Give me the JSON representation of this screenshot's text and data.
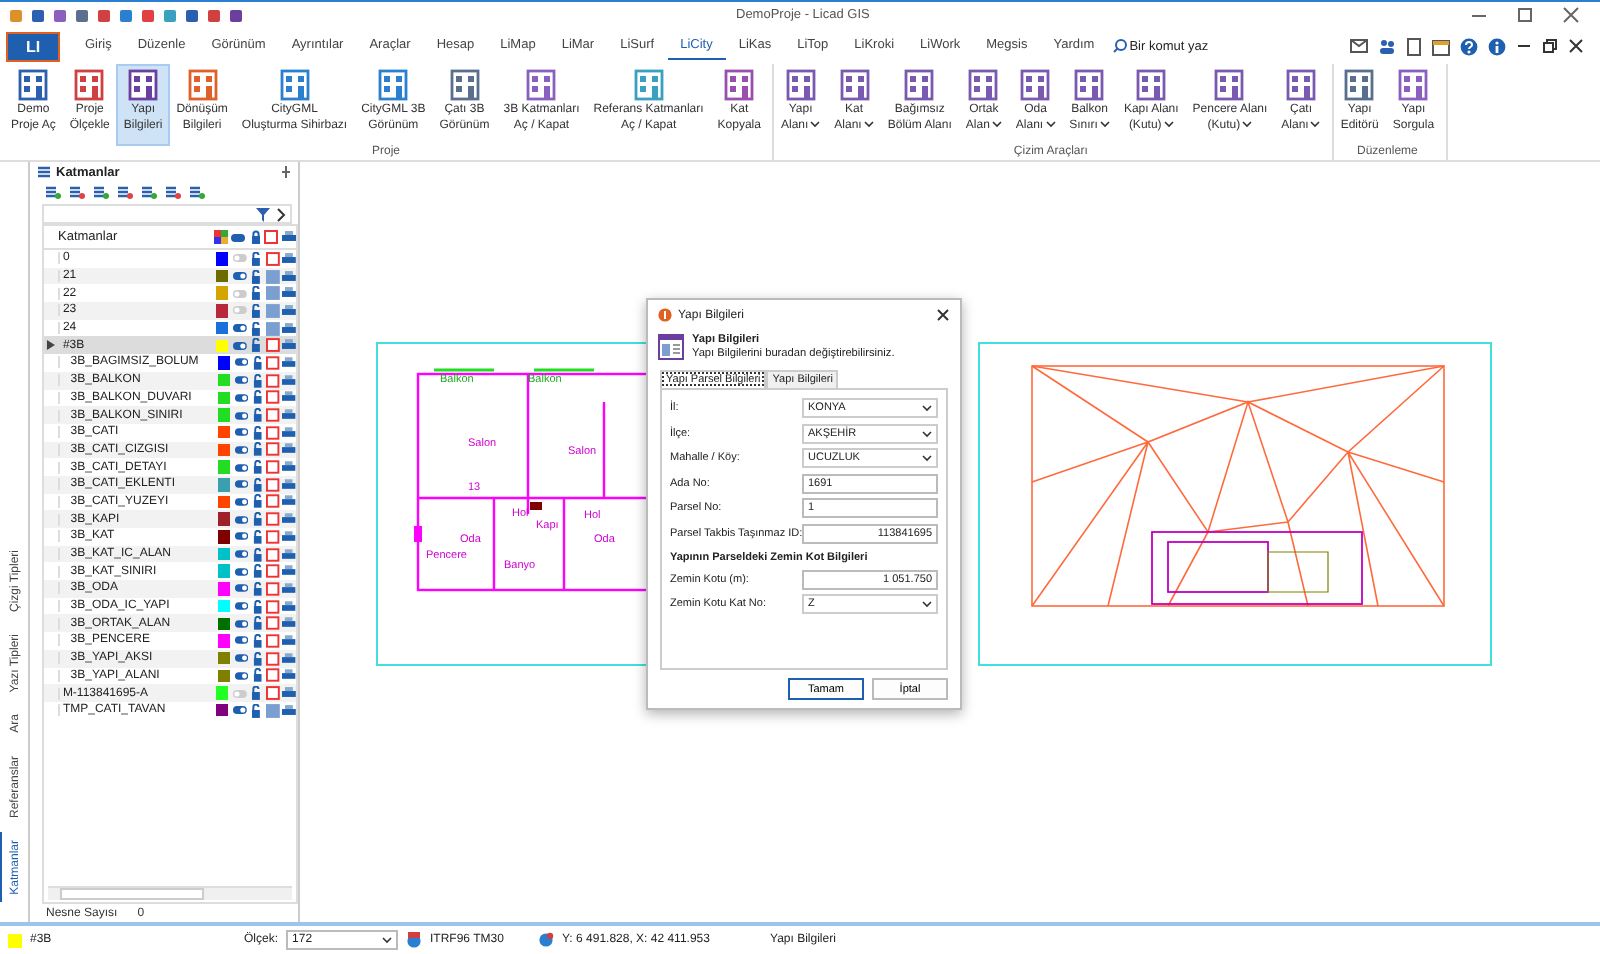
{
  "window": {
    "title": "DemoProje - Licad GIS"
  },
  "app_button": "LI",
  "menu_tabs": [
    {
      "label": "Giriş",
      "selected": false
    },
    {
      "label": "Düzenle",
      "selected": false
    },
    {
      "label": "Görünüm",
      "selected": false
    },
    {
      "label": "Ayrıntılar",
      "selected": false
    },
    {
      "label": "Araçlar",
      "selected": false
    },
    {
      "label": "Hesap",
      "selected": false
    },
    {
      "label": "LiMap",
      "selected": false
    },
    {
      "label": "LiMar",
      "selected": false
    },
    {
      "label": "LiSurf",
      "selected": false
    },
    {
      "label": "LiCity",
      "selected": true
    },
    {
      "label": "LiKas",
      "selected": false
    },
    {
      "label": "LiTop",
      "selected": false
    },
    {
      "label": "LiKroki",
      "selected": false
    },
    {
      "label": "LiWork",
      "selected": false
    },
    {
      "label": "Megsis",
      "selected": false
    },
    {
      "label": "Yardım",
      "selected": false
    }
  ],
  "command_search": {
    "placeholder": "Bir komut yaz"
  },
  "ribbon": {
    "groups": [
      {
        "label": "Proje",
        "buttons": [
          {
            "lines": [
              "Demo",
              "Proje Aç"
            ],
            "dropdown": false,
            "selected": false
          },
          {
            "lines": [
              "Proje",
              "Ölçekle"
            ],
            "dropdown": false,
            "selected": false
          },
          {
            "lines": [
              "Yapı",
              "Bilgileri"
            ],
            "dropdown": false,
            "selected": true
          },
          {
            "lines": [
              "Dönüşüm",
              "Bilgileri"
            ],
            "dropdown": false,
            "selected": false
          },
          {
            "lines": [
              "CityGML",
              "Oluşturma Sihirbazı"
            ],
            "dropdown": false,
            "selected": false
          },
          {
            "lines": [
              "CityGML 3B",
              "Görünüm"
            ],
            "dropdown": false,
            "selected": false
          },
          {
            "lines": [
              "Çatı 3B",
              "Görünüm"
            ],
            "dropdown": false,
            "selected": false
          },
          {
            "lines": [
              "3B Katmanları",
              "Aç / Kapat"
            ],
            "dropdown": false,
            "selected": false
          },
          {
            "lines": [
              "Referans Katmanları",
              "Aç / Kapat"
            ],
            "dropdown": false,
            "selected": false
          },
          {
            "lines": [
              "Kat",
              "Kopyala"
            ],
            "dropdown": false,
            "selected": false
          }
        ]
      },
      {
        "label": "Çizim Araçları",
        "buttons": [
          {
            "lines": [
              "Yapı",
              "Alanı"
            ],
            "dropdown": true,
            "selected": false
          },
          {
            "lines": [
              "Kat",
              "Alanı"
            ],
            "dropdown": true,
            "selected": false
          },
          {
            "lines": [
              "Bağımsız",
              "Bölüm Alanı"
            ],
            "dropdown": false,
            "selected": false
          },
          {
            "lines": [
              "Ortak",
              "Alan"
            ],
            "dropdown": true,
            "selected": false
          },
          {
            "lines": [
              "Oda",
              "Alanı"
            ],
            "dropdown": true,
            "selected": false
          },
          {
            "lines": [
              "Balkon",
              "Sınırı"
            ],
            "dropdown": true,
            "selected": false
          },
          {
            "lines": [
              "Kapı Alanı",
              "(Kutu)"
            ],
            "dropdown": true,
            "selected": false
          },
          {
            "lines": [
              "Pencere Alanı",
              "(Kutu)"
            ],
            "dropdown": true,
            "selected": false
          },
          {
            "lines": [
              "Çatı",
              "Alanı"
            ],
            "dropdown": true,
            "selected": false
          }
        ]
      },
      {
        "label": "Düzenleme",
        "buttons": [
          {
            "lines": [
              "Yapı",
              "Editörü"
            ],
            "dropdown": false,
            "selected": false
          },
          {
            "lines": [
              "Yapı",
              "Sorgula"
            ],
            "dropdown": false,
            "selected": false
          }
        ]
      }
    ]
  },
  "side_tabs": [
    {
      "label": "Çizgi Tipleri",
      "selected": false
    },
    {
      "label": "Yazı Tipleri",
      "selected": false
    },
    {
      "label": "Ara",
      "selected": false
    },
    {
      "label": "Referanslar",
      "selected": false
    },
    {
      "label": "Katmanlar",
      "selected": true
    }
  ],
  "layers_panel": {
    "title": "Katmanlar",
    "column_header": "Katmanlar",
    "object_count_label": "Nesne Sayısı",
    "object_count": "0",
    "layers": [
      {
        "name": "0",
        "color": "#0000ff",
        "visible": false,
        "filled": false,
        "selected": false
      },
      {
        "name": "21",
        "color": "#6b6b00",
        "visible": true,
        "filled": true,
        "selected": false
      },
      {
        "name": "22",
        "color": "#d4a500",
        "visible": false,
        "filled": true,
        "selected": false
      },
      {
        "name": "23",
        "color": "#b8283c",
        "visible": false,
        "filled": true,
        "selected": false
      },
      {
        "name": "24",
        "color": "#1a6fd8",
        "visible": true,
        "filled": true,
        "selected": false
      },
      {
        "name": "#3B",
        "color": "#ffff00",
        "visible": true,
        "filled": false,
        "selected": true,
        "children": [
          {
            "name": "3B_BAGIMSIZ_BOLUM",
            "color": "#0000ff",
            "visible": true,
            "filled": false,
            "selected": false
          },
          {
            "name": "3B_BALKON",
            "color": "#22dd22",
            "visible": true,
            "filled": false,
            "selected": false
          },
          {
            "name": "3B_BALKON_DUVARI",
            "color": "#22dd22",
            "visible": true,
            "filled": false,
            "selected": false
          },
          {
            "name": "3B_BALKON_SINIRI",
            "color": "#22dd22",
            "visible": true,
            "filled": false,
            "selected": false
          },
          {
            "name": "3B_CATI",
            "color": "#ff4400",
            "visible": true,
            "filled": false,
            "selected": false
          },
          {
            "name": "3B_CATI_CIZGISI",
            "color": "#ff4400",
            "visible": true,
            "filled": false,
            "selected": false
          },
          {
            "name": "3B_CATI_DETAYI",
            "color": "#22dd22",
            "visible": true,
            "filled": false,
            "selected": false
          },
          {
            "name": "3B_CATI_EKLENTI",
            "color": "#3aa0b0",
            "visible": true,
            "filled": false,
            "selected": false
          },
          {
            "name": "3B_CATI_YUZEYI",
            "color": "#ff4400",
            "visible": true,
            "filled": false,
            "selected": false
          },
          {
            "name": "3B_KAPI",
            "color": "#a0202a",
            "visible": true,
            "filled": false,
            "selected": false
          },
          {
            "name": "3B_KAT",
            "color": "#800000",
            "visible": true,
            "filled": false,
            "selected": false
          },
          {
            "name": "3B_KAT_IC_ALAN",
            "color": "#00c0c8",
            "visible": true,
            "filled": false,
            "selected": false
          },
          {
            "name": "3B_KAT_SINIRI",
            "color": "#00c0c8",
            "visible": true,
            "filled": false,
            "selected": false
          },
          {
            "name": "3B_ODA",
            "color": "#ff00ff",
            "visible": true,
            "filled": false,
            "selected": false
          },
          {
            "name": "3B_ODA_IC_YAPI",
            "color": "#00ffff",
            "visible": true,
            "filled": false,
            "selected": false
          },
          {
            "name": "3B_ORTAK_ALAN",
            "color": "#007000",
            "visible": true,
            "filled": false,
            "selected": false
          },
          {
            "name": "3B_PENCERE",
            "color": "#ff00ff",
            "visible": true,
            "filled": false,
            "selected": false
          },
          {
            "name": "3B_YAPI_AKSI",
            "color": "#808000",
            "visible": true,
            "filled": false,
            "selected": false
          },
          {
            "name": "3B_YAPI_ALANI",
            "color": "#808000",
            "visible": true,
            "filled": false,
            "selected": false
          }
        ]
      },
      {
        "name": "M-113841695-A",
        "color": "#22ff22",
        "visible": false,
        "filled": false,
        "selected": false
      },
      {
        "name": "TMP_CATI_TAVAN",
        "color": "#800080",
        "visible": true,
        "filled": true,
        "selected": false
      }
    ]
  },
  "plan_labels": [
    "Balkon",
    "Balkon",
    "Salon",
    "Salon",
    "13",
    "Hol",
    "Hol",
    "Kapı",
    "Oda",
    "Oda",
    "Pencere",
    "Banyo"
  ],
  "dialog": {
    "title": "Yapı Bilgileri",
    "heading": "Yapı Bilgileri",
    "subtitle": "Yapı Bilgilerini buradan değiştirebilirsiniz.",
    "tabs": [
      {
        "label": "Yapı Parsel Bilgileri",
        "selected": true
      },
      {
        "label": "Yapı Bilgileri",
        "selected": false
      }
    ],
    "fields": [
      {
        "label": "İl:",
        "value": "KONYA",
        "kind": "dropdown"
      },
      {
        "label": "İlçe:",
        "value": "AKŞEHİR",
        "kind": "dropdown"
      },
      {
        "label": "Mahalle / Köy:",
        "value": "UCUZLUK",
        "kind": "dropdown"
      },
      {
        "label": "Ada No:",
        "value": "1691",
        "kind": "text"
      },
      {
        "label": "Parsel No:",
        "value": "1",
        "kind": "text"
      },
      {
        "label": "Parsel Takbis Taşınmaz ID:",
        "value": "113841695",
        "kind": "number"
      }
    ],
    "section": "Yapının Parseldeki Zemin Kot Bilgileri",
    "section_fields": [
      {
        "label": "Zemin Kotu (m):",
        "value": "1 051.750",
        "kind": "number"
      },
      {
        "label": "Zemin Kotu Kat No:",
        "value": "Z",
        "kind": "dropdown"
      }
    ],
    "buttons": [
      "Tamam",
      "İptal"
    ]
  },
  "status_bar": {
    "layer": "#3B",
    "color": "#ffff00",
    "scale_label": "Ölçek:",
    "scale": "172",
    "crs": "ITRF96 TM30",
    "coords": "Y: 6 491.828, X: 42 411.953",
    "message": "Yapı Bilgileri"
  }
}
